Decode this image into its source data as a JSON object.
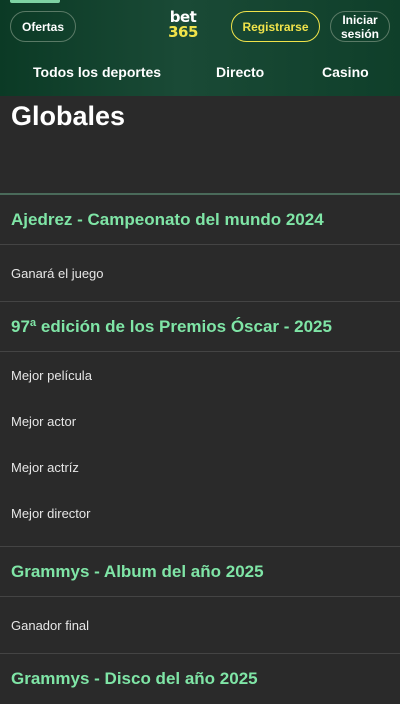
{
  "header": {
    "offers_label": "Ofertas",
    "logo_line1": "bet",
    "logo_line2": "365",
    "register_label": "Registrarse",
    "login_label": "Iniciar\nsesión",
    "nav": [
      "Todos los deportes",
      "Directo",
      "Casino"
    ],
    "colors": {
      "accent_green": "#7fe5a6",
      "brand_yellow": "#f0e34a"
    }
  },
  "page": {
    "title": "Globales"
  },
  "sections": [
    {
      "title": "Ajedrez - Campeonato del mundo 2024",
      "markets": [
        "Ganará el juego"
      ]
    },
    {
      "title": "97ª edición de los Premios Óscar - 2025",
      "markets": [
        "Mejor película",
        "Mejor actor",
        "Mejor actríz",
        "Mejor director"
      ]
    },
    {
      "title": "Grammys - Album del año 2025",
      "markets": [
        "Ganador final"
      ]
    },
    {
      "title": "Grammys - Disco del año 2025",
      "markets": []
    }
  ]
}
